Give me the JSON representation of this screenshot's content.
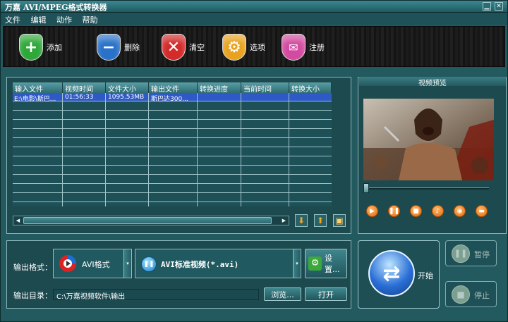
{
  "window": {
    "title": "万嘉 AVI/MPEG格式转换器"
  },
  "menu": [
    "文件",
    "编辑",
    "动作",
    "帮助"
  ],
  "toolbar": [
    {
      "label": "添加",
      "icon": "add-shield-icon",
      "color": "#2fa83a",
      "glyph": "+"
    },
    {
      "label": "删除",
      "icon": "remove-shield-icon",
      "color": "#2a72c9",
      "glyph": "−"
    },
    {
      "label": "清空",
      "icon": "clear-shield-icon",
      "color": "#d42a2a",
      "glyph": "✕"
    },
    {
      "label": "选项",
      "icon": "options-shield-icon",
      "color": "#e8a21e",
      "glyph": "⚙"
    },
    {
      "label": "注册",
      "icon": "register-shield-icon",
      "color": "#d24ba0",
      "glyph": "🛍"
    }
  ],
  "table": {
    "columns": [
      "输入文件",
      "视频时间",
      "文件大小",
      "输出文件",
      "转换进度",
      "当前时间",
      "转换大小"
    ],
    "rows": [
      [
        "E:\\电影\\斯巴...",
        "01:56:33",
        "1095.53MB",
        "斯巴达300...",
        "",
        "",
        ""
      ]
    ]
  },
  "preview": {
    "title": "视频预览"
  },
  "output": {
    "format_label": "输出格式：",
    "format_value": "AVI格式",
    "profile_value": "AVI标准视频(*.avi)",
    "settings_button": "设置...",
    "dir_label": "输出目录：",
    "dir_value": "C:\\万嘉视频软件\\输出",
    "browse_button": "浏览...",
    "open_button": "打开"
  },
  "actions": {
    "start": "开始",
    "pause": "暂停",
    "stop": "停止"
  },
  "colors": {
    "accent": "#2f59c6",
    "control_orange": "#e56a0a",
    "start_blue": "#2a6fd6"
  }
}
